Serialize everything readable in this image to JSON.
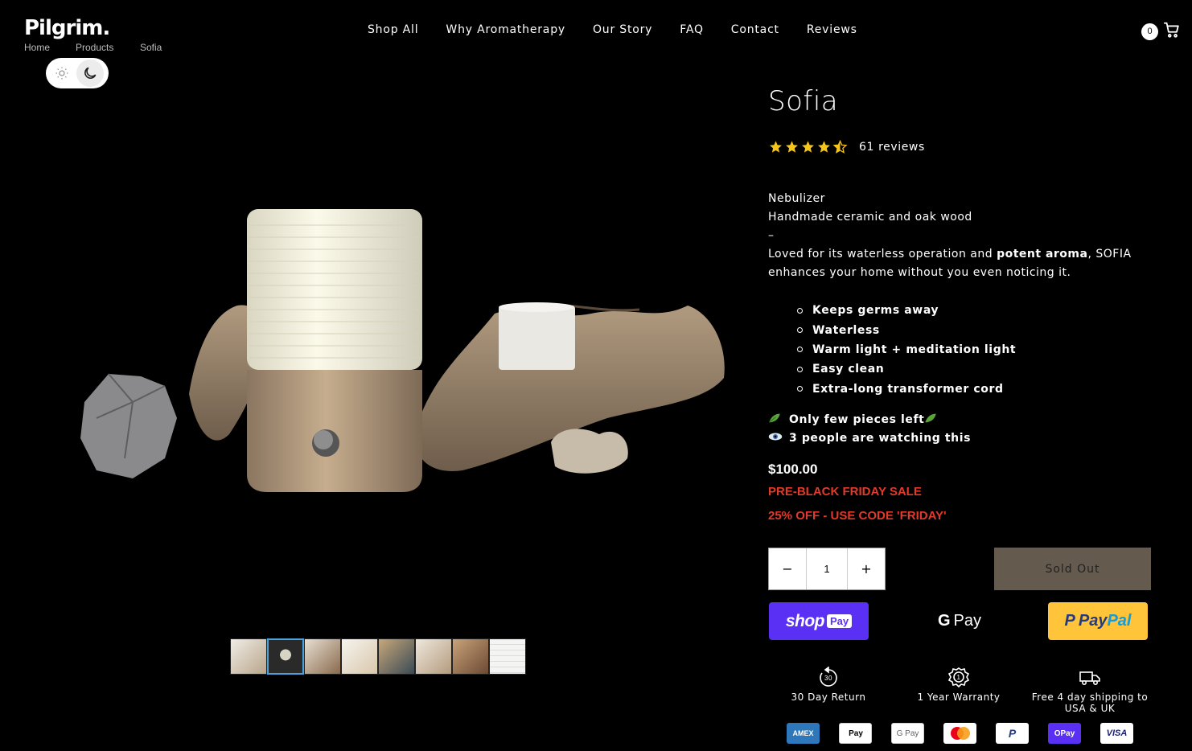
{
  "brand": {
    "logo_text": "Pilgrim."
  },
  "breadcrumb": [
    "Home",
    "Products",
    "Sofia"
  ],
  "nav": [
    "Shop All",
    "Why Aromatherapy",
    "Our Story",
    "FAQ",
    "Contact",
    "Reviews"
  ],
  "cart": {
    "count": "0"
  },
  "product": {
    "title": "Sofia",
    "rating": 4.5,
    "reviews_text": "61 reviews",
    "type": "Nebulizer",
    "material": "Handmade ceramic and oak wood",
    "separator": "–",
    "desc_prefix": "Loved for its waterless operation and ",
    "desc_bold": "potent aroma",
    "desc_suffix": ", SOFIA enhances your home without you even noticing it.",
    "features": [
      "Keeps germs away",
      "Waterless",
      "Warm light + meditation light",
      "Easy clean",
      "Extra-long transformer cord"
    ],
    "scarcity": "Only few pieces left",
    "watching": "3 people are watching this",
    "price": "$100.00",
    "sale_line1": "PRE-BLACK FRIDAY SALE",
    "sale_line2": "25% OFF - USE CODE 'FRIDAY'",
    "quantity": "1",
    "sold_out_label": "Sold Out"
  },
  "thumbnails": {
    "count": 8,
    "active_index": 1
  },
  "payments": {
    "shop_pay": {
      "text1": "shop",
      "text2": "Pay"
    },
    "gpay": {
      "g": "G",
      "text": "Pay"
    },
    "paypal": {
      "p1": "Pay",
      "p2": "Pal"
    }
  },
  "perks": [
    {
      "icon": "return-30-icon",
      "label": "30 Day Return"
    },
    {
      "icon": "warranty-icon",
      "label": "1 Year Warranty"
    },
    {
      "icon": "truck-icon",
      "label": "Free 4 day shipping to USA & UK"
    }
  ],
  "card_logos": [
    "AMEX",
    "Apple Pay",
    "G Pay",
    "Mastercard",
    "PayPal",
    "OPay",
    "VISA"
  ],
  "colors": {
    "sale": "#e23a2a",
    "shop_pay": "#5a31f4",
    "paypal": "#ffc439",
    "sold_out": "#645a4e",
    "star": "#f5c518",
    "thumb_active": "#4aa3df"
  }
}
